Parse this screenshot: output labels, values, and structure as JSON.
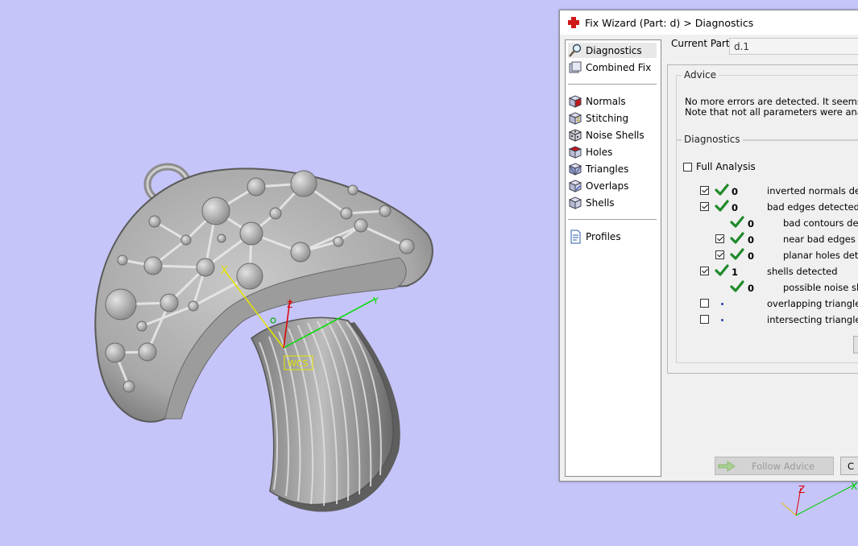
{
  "viewport": {
    "background": "#c5c5f9",
    "wcs_label": "WCS",
    "axis_x": "X",
    "axis_y": "Y",
    "axis_z": "Z",
    "corner_axis_z": "Z",
    "corner_axis_x": "X"
  },
  "dialog": {
    "title": "Fix Wizard (Part: d) > Diagnostics",
    "current_part_label": "Current Part:",
    "current_part_value": "d.1",
    "nav": {
      "top": [
        {
          "label": "Diagnostics",
          "icon": "magnifier-icon"
        },
        {
          "label": "Combined Fix",
          "icon": "combined-fix-icon"
        }
      ],
      "tools": [
        {
          "label": "Normals",
          "icon": "normals-cube-icon"
        },
        {
          "label": "Stitching",
          "icon": "stitching-cube-icon"
        },
        {
          "label": "Noise Shells",
          "icon": "noise-shells-dice-icon"
        },
        {
          "label": "Holes",
          "icon": "holes-cube-icon"
        },
        {
          "label": "Triangles",
          "icon": "triangles-cube-icon"
        },
        {
          "label": "Overlaps",
          "icon": "overlaps-cube-icon"
        },
        {
          "label": "Shells",
          "icon": "shells-cube-icon"
        }
      ],
      "bottom": [
        {
          "label": "Profiles",
          "icon": "profiles-document-icon"
        }
      ]
    },
    "advice": {
      "title": "Advice",
      "line1": "No more errors are detected. It seems that t",
      "line2": "Note that not all parameters were analysed."
    },
    "diagnostics": {
      "title": "Diagnostics",
      "full_analysis_label": "Full Analysis",
      "full_analysis_checked": false,
      "rows": [
        {
          "checked": true,
          "status": "ok",
          "count": "0",
          "label": "inverted normals detect"
        },
        {
          "checked": true,
          "status": "ok",
          "count": "0",
          "label": "bad edges detected"
        },
        {
          "checked": null,
          "status": "ok",
          "count": "0",
          "label": "bad contours detec"
        },
        {
          "checked": true,
          "status": "ok",
          "count": "0",
          "label": "near bad edges det"
        },
        {
          "checked": true,
          "status": "ok",
          "count": "0",
          "label": "planar holes detect"
        },
        {
          "checked": true,
          "status": "ok",
          "count": "1",
          "label": "shells detected"
        },
        {
          "checked": null,
          "status": "ok",
          "count": "0",
          "label": "possible noise shells"
        },
        {
          "checked": false,
          "status": "not-analysed",
          "count": "",
          "label": "overlapping triangles de"
        },
        {
          "checked": false,
          "status": "not-analysed",
          "count": "",
          "label": "intersecting triangles de"
        }
      ]
    },
    "buttons": {
      "follow_advice": "Follow Advice",
      "close": "C"
    },
    "colors": {
      "ok_tick": "#1f8a2a",
      "disabled_text": "#9a9a9a"
    }
  }
}
